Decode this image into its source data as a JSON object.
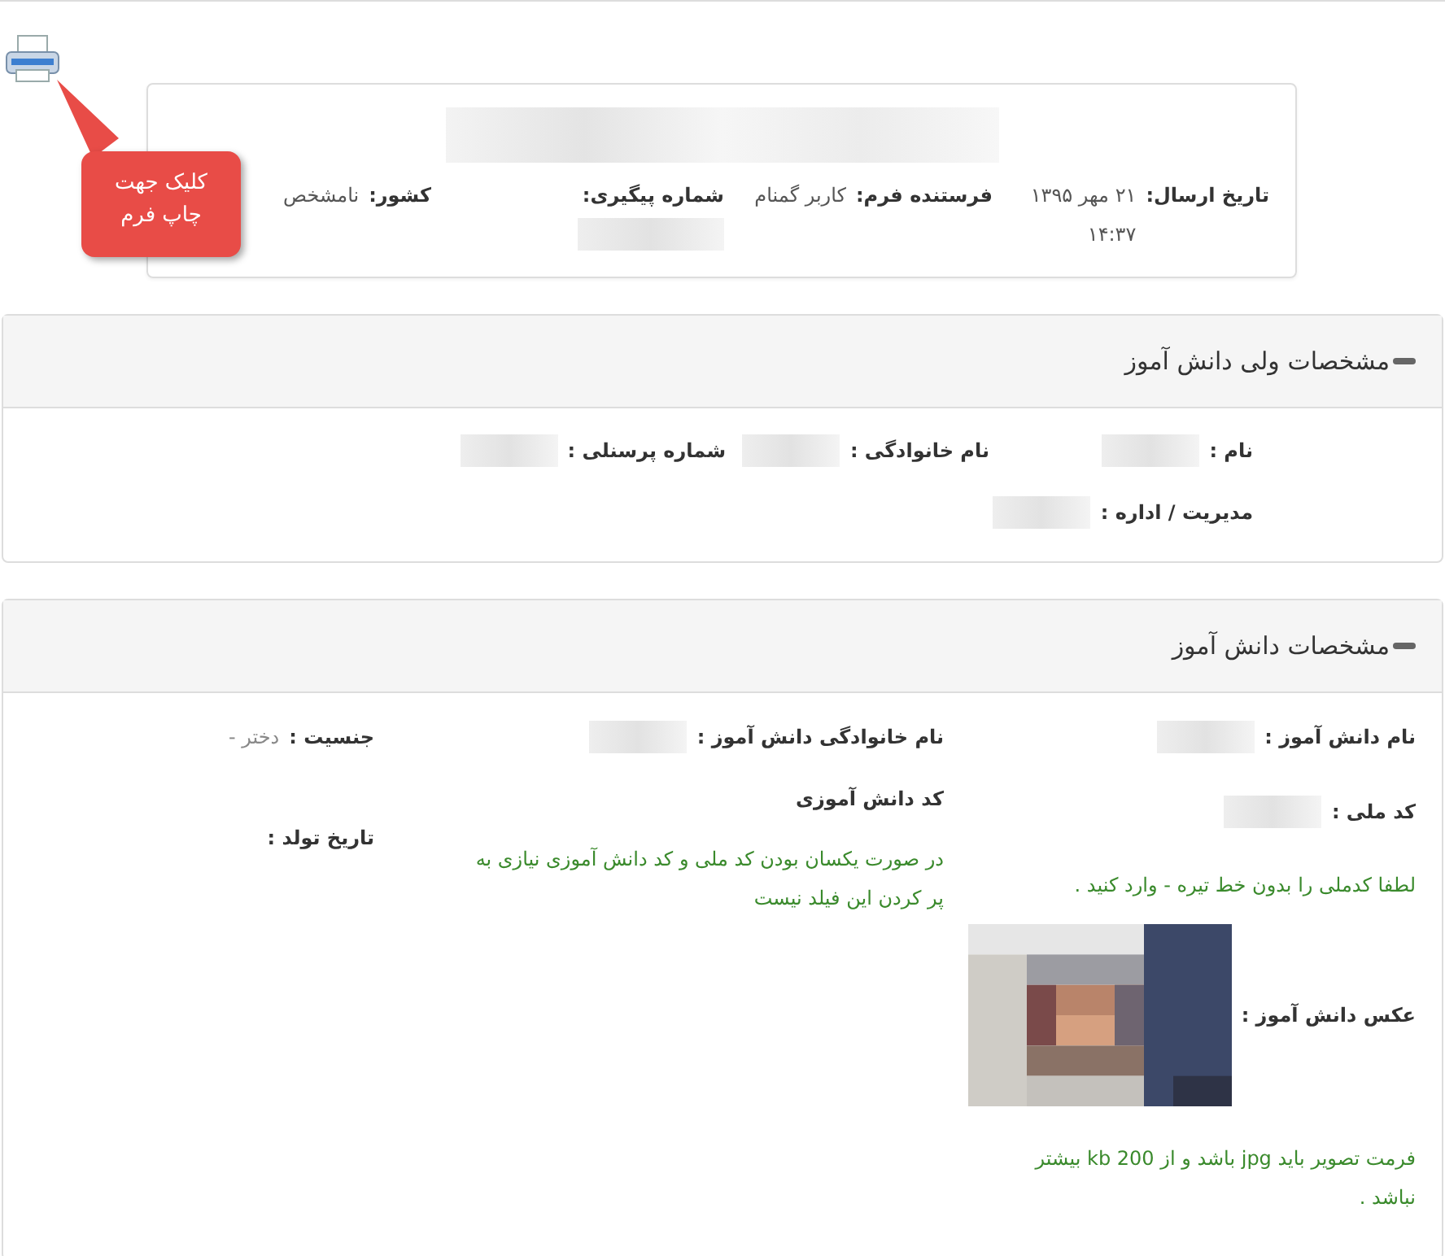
{
  "print_tooltip": {
    "text": "کلیک جهت چاپ فرم"
  },
  "header": {
    "title": {
      "kind": "redacted"
    },
    "fields": [
      {
        "label": "تاریخ ارسال:",
        "kind": "text",
        "value": "۲۱ مهر ۱۳۹۵ ۱۴:۳۷"
      },
      {
        "label": "فرستنده فرم:",
        "kind": "text",
        "value": "کاربر گمنام"
      },
      {
        "label": "شماره پیگیری:",
        "kind": "redacted"
      },
      {
        "label": "کشور:",
        "kind": "text",
        "value": "نامشخص"
      }
    ]
  },
  "guardian_panel": {
    "title": "مشخصات ولی دانش آموز",
    "fields": [
      {
        "label": "نام :",
        "kind": "redacted"
      },
      {
        "label": "نام خانوادگی :",
        "kind": "redacted"
      },
      {
        "label": "شماره پرسنلی :",
        "kind": "redacted"
      },
      {
        "label": "مدیریت / اداره :",
        "kind": "redacted"
      }
    ]
  },
  "student_panel": {
    "title": "مشخصات دانش آموز",
    "columns": [
      [
        {
          "label": "نام دانش آموز :",
          "kind": "redacted"
        },
        {
          "label": "کد ملی :",
          "kind": "redacted"
        },
        {
          "kind": "hint",
          "text": "لطفا کدملی را بدون خط تیره - وارد کنید ."
        },
        {
          "label": "عکس دانش آموز :"
        },
        {
          "kind": "hint",
          "text": "فرمت تصویر باید jpg باشد و از kb 200 بیشتر نباشد ."
        }
      ],
      [
        {
          "label": "نام خانوادگی دانش آموز :",
          "kind": "redacted"
        },
        {
          "label": "کد دانش آموزی",
          "kind": "label"
        },
        {
          "kind": "hint",
          "text": "در صورت یکسان بودن کد ملی و کد دانش آموزی نیازی به پر کردن این فیلد نیست"
        }
      ],
      [
        {
          "label": "جنسیت :",
          "kind": "text",
          "value": "دختر -"
        },
        {
          "label": "تاریخ تولد :",
          "kind": "label"
        }
      ]
    ]
  }
}
